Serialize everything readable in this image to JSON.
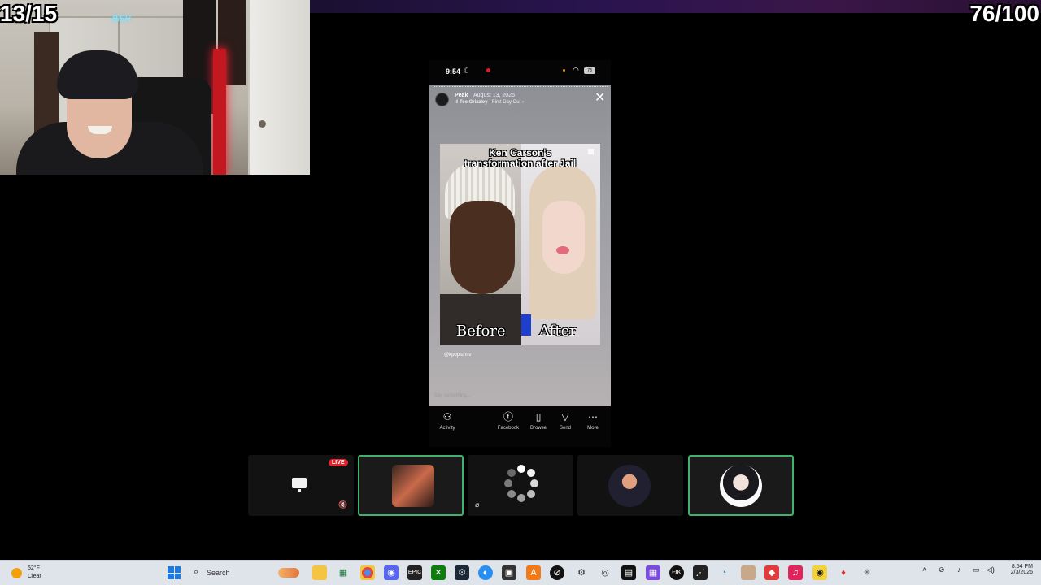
{
  "overlay": {
    "counter_left": "13/15",
    "counter_right": "76/100"
  },
  "webcam": {
    "neon_sign": "BiSH"
  },
  "phone": {
    "status": {
      "time": "9:54",
      "battery": "73"
    },
    "story": {
      "username": "Peak",
      "date": "August 13, 2025",
      "music_artist": "Tee Grizzley",
      "music_track": "· First Day Out",
      "post_title_line1": "Ken Carson's",
      "post_title_line2": "transformation after Jail",
      "label_before": "Before",
      "label_after": "After",
      "handle": "@kpopiumtv",
      "reply_placeholder": "Say something..."
    },
    "actions": [
      {
        "label": "Activity",
        "icon": "people-icon"
      },
      {
        "label": "Facebook",
        "icon": "facebook-icon"
      },
      {
        "label": "Browse",
        "icon": "browse-icon"
      },
      {
        "label": "Send",
        "icon": "send-icon"
      },
      {
        "label": "More",
        "icon": "more-icon"
      }
    ]
  },
  "participants": {
    "live_label": "LIVE"
  },
  "taskbar": {
    "weather_temp": "52°F",
    "weather_condition": "Clear",
    "search_label": "Search",
    "clock_time": "8:54 PM",
    "clock_date": "2/3/2026"
  },
  "colors": {
    "speaking_border": "#3fb36b",
    "live_red": "#e2242c",
    "taskbar_bg": "#dfe3ea"
  }
}
